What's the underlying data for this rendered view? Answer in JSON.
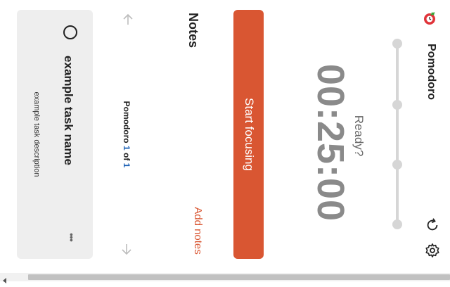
{
  "header": {
    "brand": "Pomodoro",
    "icons": [
      "tomato-icon",
      "refresh-icon",
      "gear-icon"
    ]
  },
  "timer": {
    "status": "Ready?",
    "time": "00:25:00",
    "progress_steps": 4,
    "current_step": 0
  },
  "actions": {
    "start_label": "Start focusing"
  },
  "notes": {
    "title": "Notes",
    "add_label": "Add notes"
  },
  "counter": {
    "prefix": "Pomodoro",
    "current": "1",
    "of": "of",
    "total": "1"
  },
  "task": {
    "name": "example task name",
    "description": "example task description",
    "menu": "•••"
  },
  "colors": {
    "accent": "#d95632",
    "counter_number": "#1a5fb4",
    "card_bg": "#eeeeee"
  }
}
